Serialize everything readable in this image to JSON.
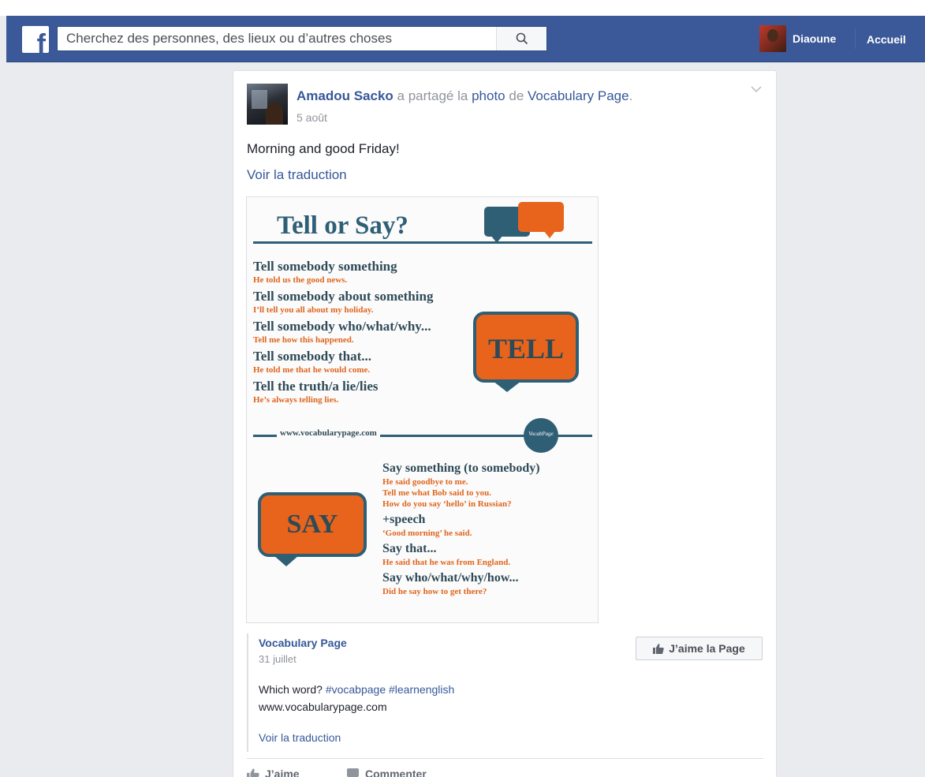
{
  "topbar": {
    "logo": "f",
    "search_placeholder": "Cherchez des personnes, des lieux ou d’autres choses",
    "profile_name": "Diaoune",
    "home_label": "Accueil"
  },
  "post": {
    "author": "Amadou Sacko",
    "shared_verb": "a partagé la",
    "photo_word": "photo",
    "from_word": "de",
    "page_name": "Vocabulary Page",
    "date": "5 août",
    "text": "Morning and good Friday!",
    "translate": "Voir la traduction"
  },
  "poster": {
    "title": "Tell or Say?",
    "tell_rules": [
      {
        "rule": "Tell somebody something",
        "example": "He told us the good news."
      },
      {
        "rule": "Tell somebody about something",
        "example": "I’ll tell you all about my holiday."
      },
      {
        "rule": "Tell somebody who/what/why...",
        "example": "Tell me how this happened."
      },
      {
        "rule": "Tell somebody that...",
        "example": "He told me that he would come."
      },
      {
        "rule": "Tell the truth/a lie/lies",
        "example": "He’s always telling lies."
      }
    ],
    "tell_word": "TELL",
    "website": "www.vocabularypage.com",
    "seal_text": "VocabPage",
    "say_word": "SAY",
    "say_rules": [
      {
        "rule": "Say something (to somebody)",
        "examples": [
          "He said goodbye to me.",
          "Tell me what Bob said to you.",
          "How do you say ‘hello’ in Russian?"
        ]
      },
      {
        "rule": "+speech",
        "examples": [
          "‘Good morning’ he said."
        ]
      },
      {
        "rule": "Say that...",
        "examples": [
          "He said that he was from England."
        ]
      },
      {
        "rule": "Say who/what/why/how...",
        "examples": [
          "Did he say how to get there?"
        ]
      }
    ],
    "colors": {
      "navy": "#2e5f75",
      "orange": "#e8641c"
    }
  },
  "shared": {
    "page_name": "Vocabulary Page",
    "date": "31 juillet",
    "text_prefix": "Which word?",
    "hashtags": "#vocabpage #learnenglish",
    "url": "www.vocabularypage.com",
    "translate": "Voir la traduction",
    "like_page_label": "J’aime la Page"
  },
  "actions": {
    "like_label": "J’aime",
    "comment_label": "Commenter"
  },
  "icons": {
    "search": "search-icon",
    "thumbs_up": "thumbs-up-icon",
    "comment": "comment-icon",
    "chevron": "chevron-down-icon"
  },
  "colors": {
    "brand": "#3b5998",
    "link": "#365899",
    "background": "#e9ebee"
  }
}
